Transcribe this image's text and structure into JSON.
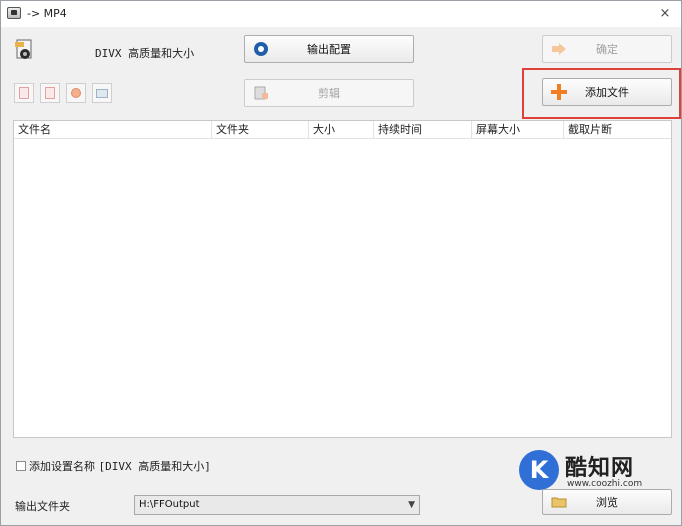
{
  "window": {
    "title": "-> MP4",
    "close_glyph": "×"
  },
  "preset": {
    "label": "DIVX 高质量和大小",
    "icon": "video-preset-icon"
  },
  "buttons": {
    "output_config": "输出配置",
    "confirm": "确定",
    "clip": "剪辑",
    "add_file": "添加文件",
    "browse": "浏览"
  },
  "tools": [
    "clear-icon",
    "remove-icon",
    "play-icon",
    "info-icon"
  ],
  "table": {
    "columns": [
      "文件名",
      "文件夹",
      "大小",
      "持续时间",
      "屏幕大小",
      "截取片断"
    ],
    "rows": []
  },
  "options": {
    "add_setting_name": "添加设置名称",
    "add_setting_value": "[DIVX 高质量和大小]",
    "checked": false
  },
  "output": {
    "label": "输出文件夹",
    "folder": "H:\\FFOutput"
  },
  "watermark": {
    "logo_letter": "K",
    "name": "酷知网",
    "url": "www.coozhi.com"
  },
  "colors": {
    "highlight": "#e0403a",
    "add_icon": "#f07d22",
    "output_config_icon": "#1f5faa"
  }
}
